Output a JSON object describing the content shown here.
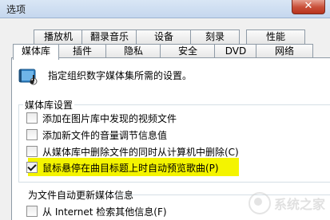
{
  "window": {
    "title": "选项"
  },
  "tabs_back": [
    "播放机",
    "翻录音乐",
    "设备",
    "刻录",
    "性能"
  ],
  "tabs_front": [
    "媒体库",
    "插件",
    "隐私",
    "安全",
    "DVD",
    "网络"
  ],
  "active_tab": "媒体库",
  "panel": {
    "description": "指定组织数字媒体集所需的设置。",
    "group1_label": "媒体库设置",
    "options": [
      {
        "label": "添加在图片库中发现的视频文件",
        "checked": false
      },
      {
        "label": "添加新文件的音量调节信息值",
        "checked": false
      },
      {
        "label": "从媒体库中删除文件的同时从计算机中删除(C)",
        "checked": false
      },
      {
        "label": "鼠标悬停在曲目标题上时自动预览歌曲(P)",
        "checked": true
      }
    ],
    "group2_label": "为文件自动更新媒体信息",
    "internet_option": {
      "label": "从 Internet 检索其他信息(F)",
      "checked": false
    }
  },
  "watermark": {
    "text": "系统之家"
  }
}
